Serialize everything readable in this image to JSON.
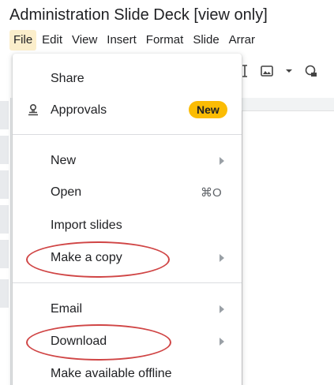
{
  "document": {
    "title": "Administration Slide Deck [view only]"
  },
  "menubar": {
    "items": [
      {
        "label": "File",
        "active": true
      },
      {
        "label": "Edit"
      },
      {
        "label": "View"
      },
      {
        "label": "Insert"
      },
      {
        "label": "Format"
      },
      {
        "label": "Slide"
      },
      {
        "label": "Arrar"
      }
    ]
  },
  "file_menu": {
    "share": {
      "label": "Share"
    },
    "approvals": {
      "label": "Approvals",
      "badge": "New",
      "icon": "approvals-icon"
    },
    "new": {
      "label": "New",
      "has_submenu": true
    },
    "open": {
      "label": "Open",
      "shortcut": "⌘O"
    },
    "import_slides": {
      "label": "Import slides"
    },
    "make_copy": {
      "label": "Make a copy",
      "has_submenu": true,
      "circled": true
    },
    "email": {
      "label": "Email",
      "has_submenu": true
    },
    "download": {
      "label": "Download",
      "has_submenu": true,
      "circled": true
    },
    "make_offline": {
      "label": "Make available offline"
    }
  },
  "colors": {
    "active_menu_bg": "#fbeecb",
    "badge_bg": "#fbbc04",
    "annotation_red": "#d04545",
    "text": "#202124"
  }
}
